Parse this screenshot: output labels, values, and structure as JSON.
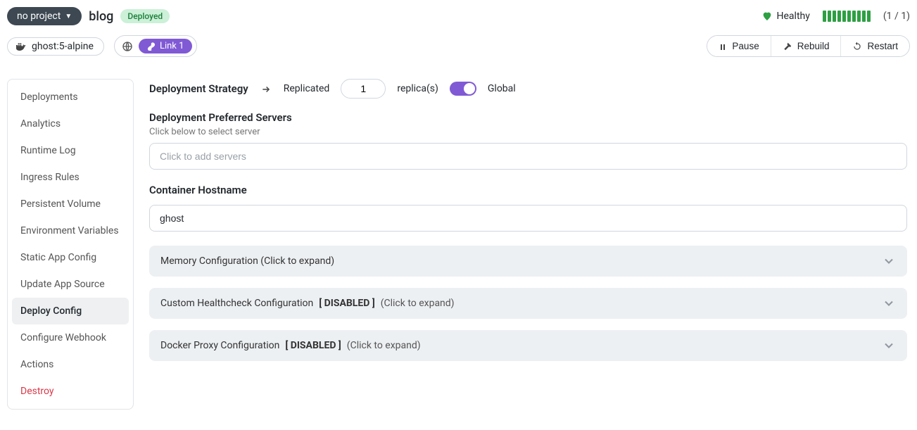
{
  "header": {
    "project_selector": "no project",
    "title": "blog",
    "status_badge": "Deployed",
    "health_label": "Healthy",
    "replica_counter": "(1 / 1)",
    "image_tag": "ghost:5-alpine",
    "link_chip": "Link 1",
    "actions": {
      "pause": "Pause",
      "rebuild": "Rebuild",
      "restart": "Restart"
    }
  },
  "sidebar": {
    "items": [
      {
        "label": "Deployments",
        "active": false
      },
      {
        "label": "Analytics",
        "active": false
      },
      {
        "label": "Runtime Log",
        "active": false
      },
      {
        "label": "Ingress Rules",
        "active": false
      },
      {
        "label": "Persistent Volume",
        "active": false
      },
      {
        "label": "Environment Variables",
        "active": false
      },
      {
        "label": "Static App Config",
        "active": false
      },
      {
        "label": "Update App Source",
        "active": false
      },
      {
        "label": "Deploy Config",
        "active": true
      },
      {
        "label": "Configure Webhook",
        "active": false
      },
      {
        "label": "Actions",
        "active": false
      },
      {
        "label": "Destroy",
        "active": false,
        "danger": true
      }
    ]
  },
  "main": {
    "strategy": {
      "label": "Deployment Strategy",
      "replicated_label": "Replicated",
      "replicas_value": "1",
      "replicas_suffix": "replica(s)",
      "global_label": "Global"
    },
    "preferred_servers": {
      "title": "Deployment Preferred Servers",
      "subtitle": "Click below to select server",
      "placeholder": "Click to add servers"
    },
    "hostname": {
      "title": "Container Hostname",
      "value": "ghost"
    },
    "accordions": [
      {
        "title": "Memory Configuration",
        "disabled": false,
        "hint": "(Click to expand)"
      },
      {
        "title": "Custom Healthcheck Configuration",
        "disabled": true,
        "disabled_tag": "[ DISABLED ]",
        "hint": "(Click to expand)"
      },
      {
        "title": "Docker Proxy Configuration",
        "disabled": true,
        "disabled_tag": "[ DISABLED ]",
        "hint": "(Click to expand)"
      }
    ]
  }
}
